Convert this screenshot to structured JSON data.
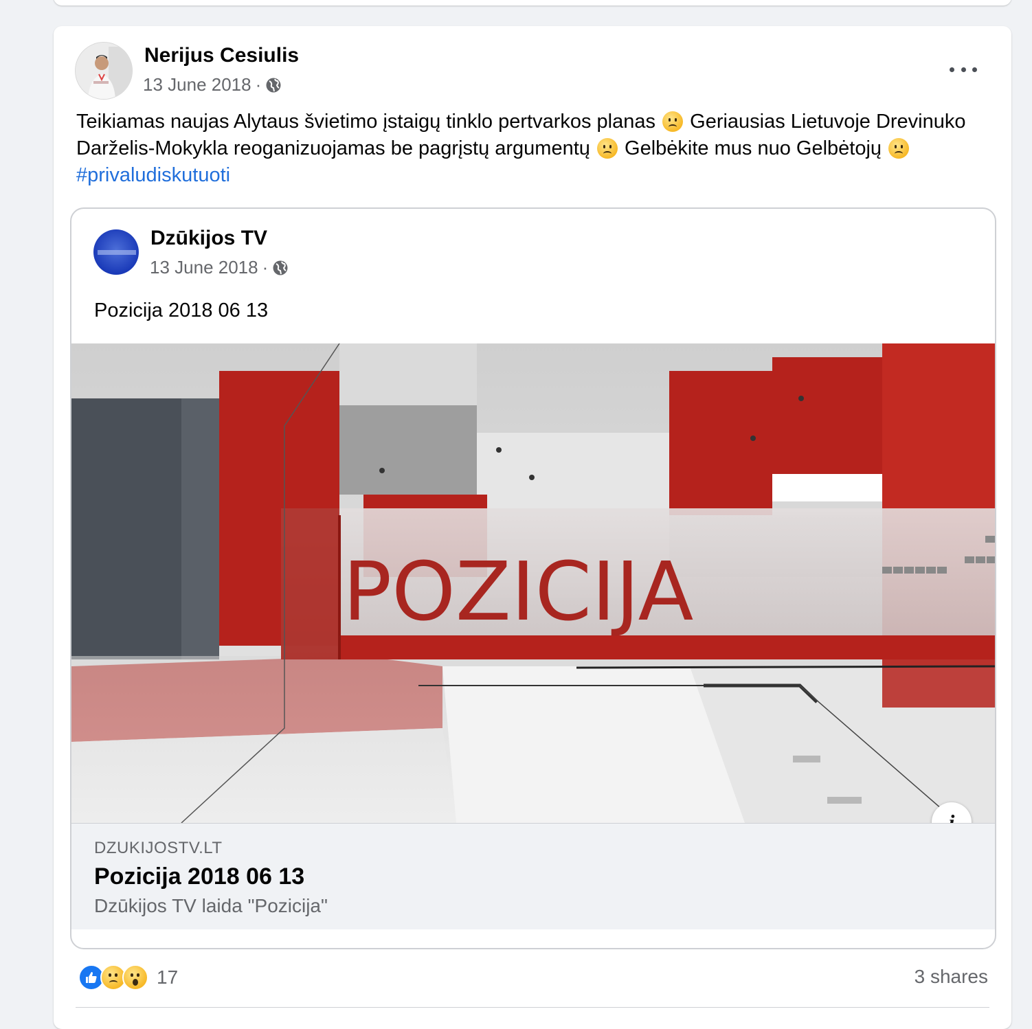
{
  "post": {
    "author": "Nerijus Cesiulis",
    "date": "13 June 2018",
    "dot": "·",
    "privacy_icon": "globe-icon",
    "text_parts": [
      "Teikiamas naujas Alytaus švietimo įstaigų tinklo pertvarkos planas",
      "Geriausias Lietuvoje Drevinuko Darželis-Mokykla reoganizuojamas be pagrįstų argumentų",
      "Gelbėkite mus nuo Gelbėtojų"
    ],
    "hashtag": "#privaludiskutuoti",
    "emoji": "confused-face-emoji"
  },
  "shared": {
    "page_name": "Dzūkijos TV",
    "date": "13 June 2018",
    "dot": "·",
    "text": "Pozicija 2018 06 13",
    "media_title_text": "POZICIJA",
    "info_label": "i",
    "link": {
      "domain": "DZUKIJOSTV.LT",
      "title": "Pozicija 2018 06 13",
      "description": "Dzūkijos TV laida \"Pozicija\""
    }
  },
  "footer": {
    "reaction_icons": [
      "like-reaction-icon",
      "sad-reaction-icon",
      "wow-reaction-icon"
    ],
    "reaction_count": "17",
    "shares": "3 shares"
  },
  "colors": {
    "accent": "#1877f2",
    "hashtag": "#216fdb",
    "studio_red": "#b5221c",
    "muted_text": "#65676b"
  }
}
